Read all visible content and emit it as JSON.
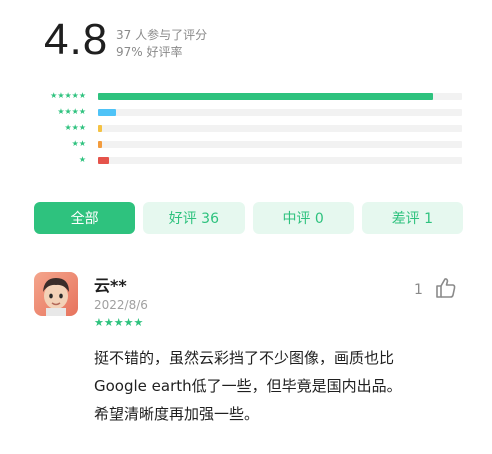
{
  "rating": {
    "score": "4.8",
    "participants": "37 人参与了评分",
    "positive_rate": "97% 好评率"
  },
  "distribution": [
    {
      "stars": "★★★★★",
      "fraction": 0.92,
      "color": "#2ec27e"
    },
    {
      "stars": "★★★★",
      "fraction": 0.05,
      "color": "#4fc3f7"
    },
    {
      "stars": "★★★",
      "fraction": 0.01,
      "color": "#f5c242"
    },
    {
      "stars": "★★",
      "fraction": 0.01,
      "color": "#f39c3d"
    },
    {
      "stars": "★",
      "fraction": 0.03,
      "color": "#e5534b"
    }
  ],
  "tabs": [
    {
      "label": "全部",
      "active": true
    },
    {
      "label": "好评 36",
      "active": false
    },
    {
      "label": "中评 0",
      "active": false
    },
    {
      "label": "差评 1",
      "active": false
    }
  ],
  "review": {
    "user": "云**",
    "date": "2022/8/6",
    "stars": "★★★★★",
    "likes": "1",
    "text_lines": [
      "挺不错的，虽然云彩挡了不少图像，画质也比",
      "Google earth低了一些，但毕竟是国内出品。",
      "希望清晰度再加强一些。"
    ]
  }
}
